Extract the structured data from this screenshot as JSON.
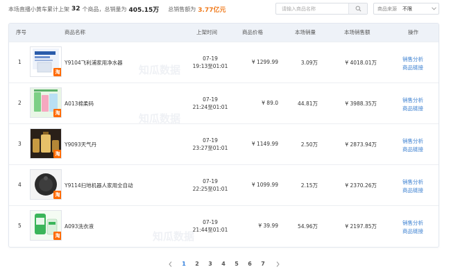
{
  "summary": {
    "prefix": "本场直播小黄车累计上架",
    "count": "32",
    "count_unit": "个商品，总销量为",
    "volume": "405.15万",
    "sales_label": "总销售额为",
    "sales": "3.77亿元"
  },
  "search": {
    "placeholder": "请输入商品名称"
  },
  "source_filter": {
    "label": "商品来源",
    "value": "不限"
  },
  "columns": {
    "index": "序号",
    "name": "商品名称",
    "time": "上架时间",
    "price": "商品价格",
    "volume": "本场销量",
    "sales": "本场销售额",
    "action": "操作"
  },
  "rows": [
    {
      "index": "1",
      "name": "Y9104飞利浦家用净水器",
      "date": "07-19",
      "range": "19:13至01:01",
      "price": "¥ 1299.99",
      "volume": "3.09万",
      "sales": "¥ 4018.01万",
      "analysis": "销售分析",
      "link": "商品链接",
      "badge": "淘"
    },
    {
      "index": "2",
      "name": "A013棉柔码",
      "date": "07-19",
      "range": "21:24至01:01",
      "price": "¥ 89.0",
      "volume": "44.81万",
      "sales": "¥ 3988.35万",
      "analysis": "销售分析",
      "link": "商品链接",
      "badge": "淘"
    },
    {
      "index": "3",
      "name": "Y9093天气丹",
      "date": "07-19",
      "range": "23:27至01:01",
      "price": "¥ 1149.99",
      "volume": "2.50万",
      "sales": "¥ 2873.94万",
      "analysis": "销售分析",
      "link": "商品链接",
      "badge": "淘"
    },
    {
      "index": "4",
      "name": "Y9114扫地机器人家用全自动",
      "date": "07-19",
      "range": "22:25至01:01",
      "price": "¥ 1099.99",
      "volume": "2.15万",
      "sales": "¥ 2370.26万",
      "analysis": "销售分析",
      "link": "商品链接",
      "badge": "淘"
    },
    {
      "index": "5",
      "name": "A093洗衣液",
      "date": "07-19",
      "range": "21:44至01:01",
      "price": "¥ 39.99",
      "volume": "54.96万",
      "sales": "¥ 2197.85万",
      "analysis": "销售分析",
      "link": "商品链接",
      "badge": "淘"
    }
  ],
  "pagination": {
    "pages": [
      "1",
      "2",
      "3",
      "4",
      "5",
      "6",
      "7"
    ],
    "current": "1"
  },
  "watermark": "知瓜数据",
  "colors": {
    "accent": "#2f7ddc",
    "money": "#f07b1d",
    "link": "#3a7fd0",
    "header_bg": "#eef2f8"
  }
}
